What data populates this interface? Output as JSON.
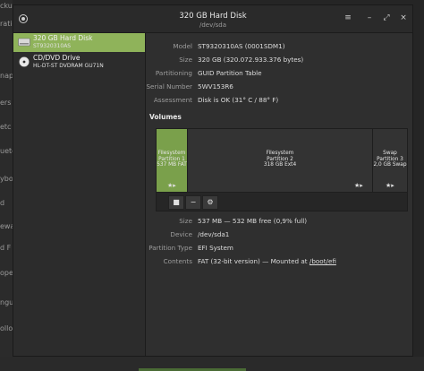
{
  "background_labels": [
    "cku",
    "ration",
    "nap",
    "ers",
    "etc",
    "uetc",
    "yboa",
    "d",
    "ewa",
    "d F",
    "opea",
    "ngu",
    "ollo"
  ],
  "header": {
    "title": "320 GB Hard Disk",
    "subtitle": "/dev/sda",
    "menu_icon": "hamburger-icon",
    "minimize_icon": "minimize-icon",
    "restore_icon": "restore-icon",
    "close_icon": "close-icon"
  },
  "sidebar": {
    "drives": [
      {
        "name": "320 GB Hard Disk",
        "sub": "ST9320310AS",
        "icon": "hard-disk-icon",
        "selected": true
      },
      {
        "name": "CD/DVD Drive",
        "sub": "HL-DT-ST DVDRAM GU71N",
        "icon": "optical-disc-icon",
        "selected": false
      }
    ]
  },
  "disk_info": {
    "model_label": "Model",
    "model": "ST9320310AS (0001SDM1)",
    "size_label": "Size",
    "size": "320 GB (320.072.933.376 bytes)",
    "partitioning_label": "Partitioning",
    "partitioning": "GUID Partition Table",
    "serial_label": "Serial Number",
    "serial": "5WV153R6",
    "assessment_label": "Assessment",
    "assessment": "Disk is OK (31° C / 88° F)"
  },
  "volumes": {
    "title": "Volumes",
    "partitions": [
      {
        "line1": "Filesystem",
        "line2": "Partition 1",
        "line3": "537 MB FAT"
      },
      {
        "line1": "Filesystem",
        "line2": "Partition 2",
        "line3": "318 GB Ext4"
      },
      {
        "line1": "Swap",
        "line2": "Partition 3",
        "line3": "2,0 GB Swap"
      }
    ],
    "toolbar": {
      "stop_icon": "stop-icon",
      "minus_icon": "minus-icon",
      "settings_icon": "gears-icon"
    }
  },
  "partition_info": {
    "size_label": "Size",
    "size": "537 MB — 532 MB free (0,9% full)",
    "device_label": "Device",
    "device": "/dev/sda1",
    "type_label": "Partition Type",
    "type": "EFI System",
    "contents_label": "Contents",
    "contents": "FAT (32-bit version) — Mounted at",
    "mount_link": "/boot/efi"
  },
  "colors": {
    "accent": "#8fb35a",
    "selected_partition": "#7aa04b",
    "background": "#2f2f2f"
  }
}
